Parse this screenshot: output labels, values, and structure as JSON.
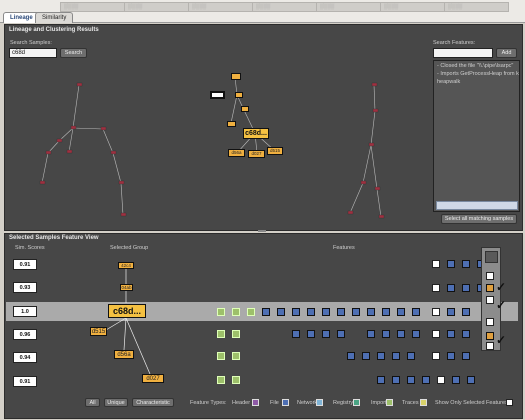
{
  "tabs": [
    {
      "label": "Lineage",
      "active": true
    },
    {
      "label": "Similarity",
      "active": false
    }
  ],
  "lineage_panel": {
    "title": "Lineage and Clustering Results",
    "search_samples_label": "Search Samples:",
    "search_samples_value": "c68d",
    "search_button": "Search",
    "search_features_label": "Search Features:",
    "add_button": "Add",
    "feature_results": [
      "- Closed the file \"\\\\.\\pipe\\lsarpc\"",
      "- Imports GetProcessHeap from kernel32.dll",
      "heapwalk"
    ],
    "select_all_button": "Select all matching samples",
    "graph": {
      "root_label": "c68d...",
      "small_nodes": [
        "d56a",
        "d027",
        "d515",
        "d04b",
        "d4a8",
        "d38d"
      ]
    }
  },
  "feature_panel": {
    "title": "Selected Samples Feature View",
    "col_sim": "Sim. Scores",
    "col_group": "Selected Group",
    "col_features": "Features",
    "rows": [
      {
        "score": "0.91"
      },
      {
        "score": "0.93"
      },
      {
        "score": "1.0",
        "selected": true
      },
      {
        "score": "0.96"
      },
      {
        "score": "0.94"
      },
      {
        "score": "0.91"
      }
    ],
    "group_nodes": {
      "n1": "42c4",
      "n2": "04ab",
      "root": "c68d...",
      "a": "d515",
      "b": "d56a",
      "c": "d027"
    },
    "buttons": {
      "all": "All",
      "unique": "Unique",
      "characteristic": "Characteristic"
    },
    "legend": {
      "feature_types_label": "Feature Types:",
      "items": [
        {
          "label": "Header",
          "color": "#8e5aa6"
        },
        {
          "label": "File",
          "color": "#4e6fb3"
        },
        {
          "label": "Network",
          "color": "#7fb4d6"
        },
        {
          "label": "Registry",
          "color": "#4aa383"
        },
        {
          "label": "Import",
          "color": "#9dc06a"
        },
        {
          "label": "Traces",
          "color": "#d9d26a"
        }
      ],
      "show_only_label": "Show Only Selected Features:"
    }
  },
  "colors": {
    "panel": "#474747",
    "node": "#f0b040",
    "selected_row": "#aaaaaa"
  }
}
